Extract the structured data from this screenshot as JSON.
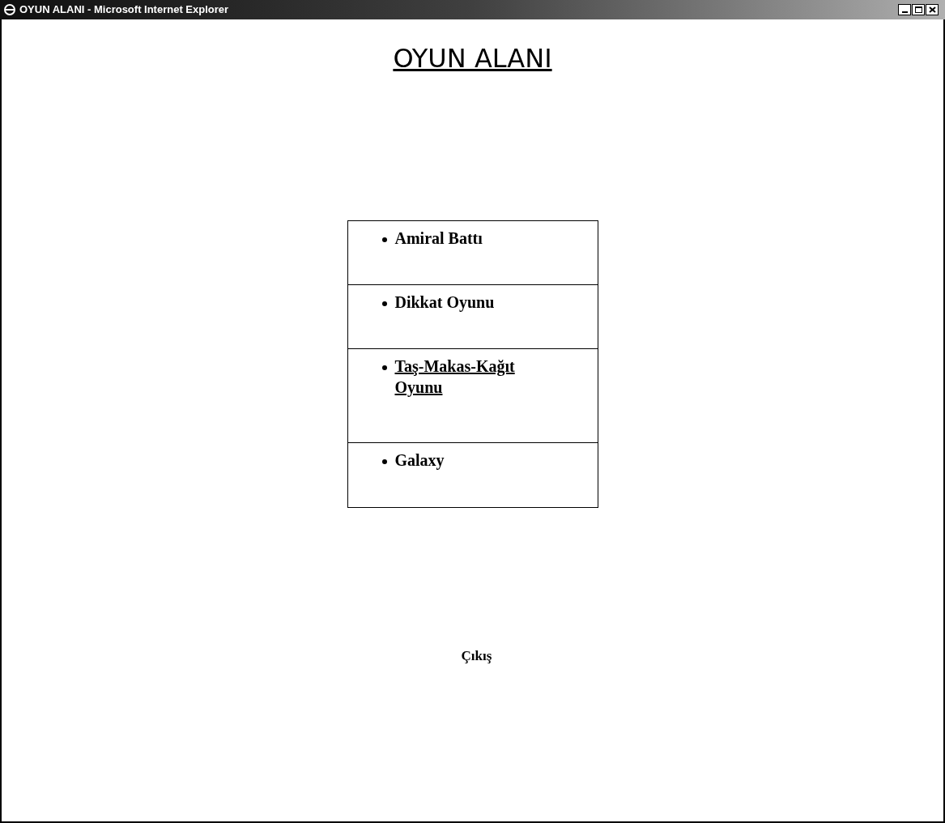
{
  "window": {
    "title": "OYUN ALANI - Microsoft Internet Explorer"
  },
  "heading": "OYUN ALANI",
  "games": [
    {
      "label": "Amiral Battı",
      "hovered": false
    },
    {
      "label": "Dikkat Oyunu",
      "hovered": false
    },
    {
      "label": "Taş-Makas-Kağıt Oyunu",
      "hovered": true
    },
    {
      "label": "Galaxy",
      "hovered": false
    }
  ],
  "exit_link": "Çıkış"
}
